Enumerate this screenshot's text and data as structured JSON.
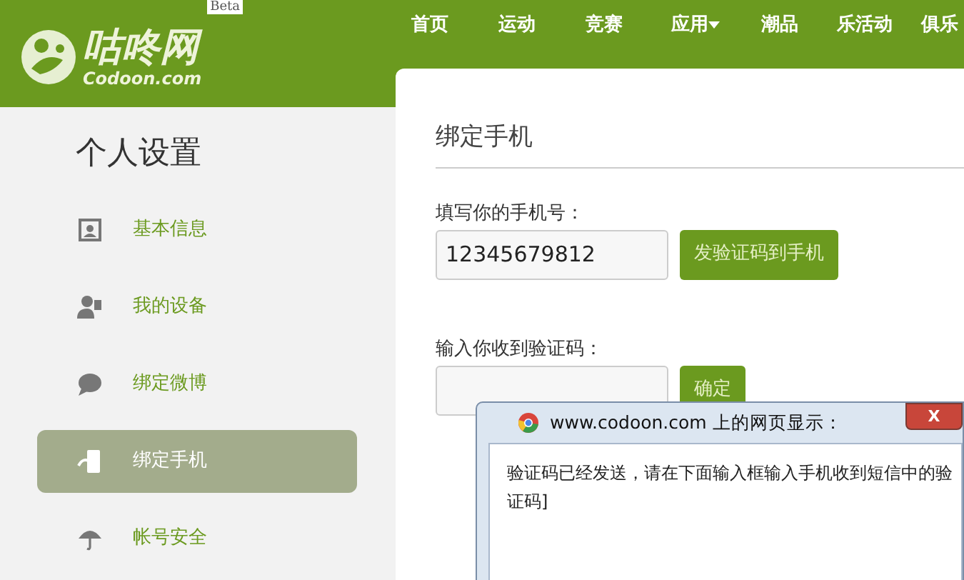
{
  "header": {
    "logo_text": "咕咚网",
    "logo_domain": "Codoon.com",
    "beta_badge": "Beta",
    "nav": [
      {
        "label": "首页",
        "dropdown": false
      },
      {
        "label": "运动",
        "dropdown": false
      },
      {
        "label": "竞赛",
        "dropdown": false
      },
      {
        "label": "应用",
        "dropdown": true
      },
      {
        "label": "潮品",
        "dropdown": false
      },
      {
        "label": "乐活动",
        "dropdown": false
      },
      {
        "label": "俱乐",
        "dropdown": false
      }
    ]
  },
  "sidebar": {
    "title": "个人设置",
    "items": [
      {
        "label": "基本信息",
        "selected": false
      },
      {
        "label": "我的设备",
        "selected": false
      },
      {
        "label": "绑定微博",
        "selected": false
      },
      {
        "label": "绑定手机",
        "selected": true
      },
      {
        "label": "帐号安全",
        "selected": false
      }
    ]
  },
  "main": {
    "title": "绑定手机",
    "fields": [
      {
        "label": "填写你的手机号：",
        "value": "12345679812",
        "button": "发验证码到手机"
      },
      {
        "label": "输入你收到验证码：",
        "button": "确定"
      }
    ]
  },
  "dialog": {
    "title": "www.codoon.com 上的网页显示：",
    "close": "X",
    "message": "验证码已经发送，请在下面输入框输入手机收到短信中的验证码]"
  }
}
